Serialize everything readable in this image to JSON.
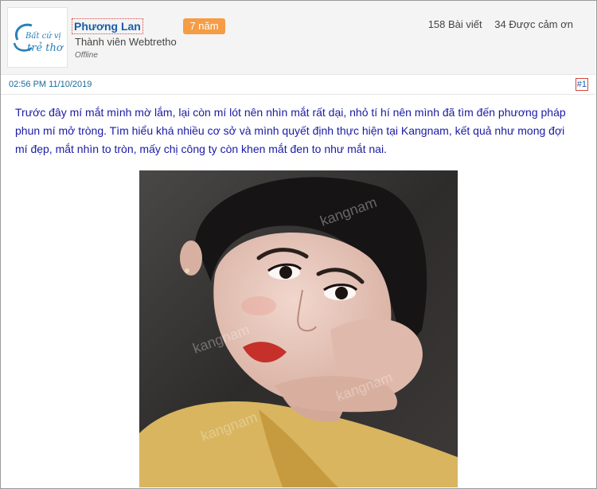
{
  "post": {
    "avatar_lines": [
      "Bất cứ vị",
      "trẻ thơ"
    ],
    "username": "Phương Lan",
    "years_badge": "7 năm",
    "role": "Thành viên Webtretho",
    "status": "Offline",
    "stats": {
      "posts": "158 Bài viết",
      "thanks": "34 Được cảm ơn"
    },
    "timestamp": "02:56 PM 11/10/2019",
    "post_number": "#1",
    "body": "Trước đây mí mắt mình mờ lắm, lại còn mí lót nên nhìn mắt rất dại, nhỏ tí hí nên mình đã tìm đến phương pháp phun mí mở tròng. Tìm hiểu khá nhiều cơ sở và mình quyết định thực hiện tại Kangnam, kết quả như mong đợi mí đẹp, mắt nhìn to tròn, mấy chị công ty còn khen mắt đen to như mắt nai.",
    "photo_watermark": "kangnam"
  },
  "colors": {
    "link": "#1b5ea8",
    "badge": "#f59c45",
    "body_text": "#1a1aa6"
  }
}
